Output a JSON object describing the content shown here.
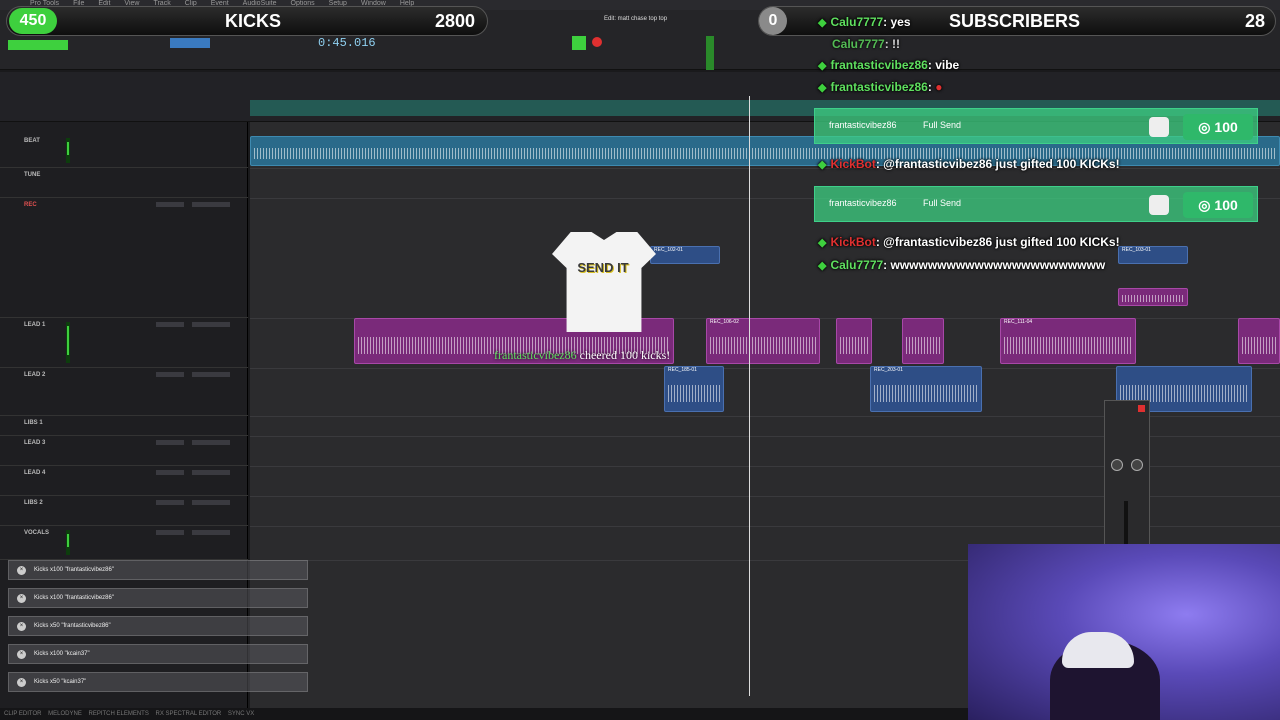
{
  "daw": {
    "menu": [
      "Pro Tools",
      "File",
      "Edit",
      "View",
      "Track",
      "Clip",
      "Event",
      "AudioSuite",
      "Options",
      "Setup",
      "Window",
      "Help"
    ],
    "counter": "0:45.016",
    "title": "Edit: matt chase top top",
    "tracks": [
      {
        "name": "BEAT"
      },
      {
        "name": "TUNE"
      },
      {
        "name": "REC"
      },
      {
        "name": "LEAD 1"
      },
      {
        "name": "LEAD 2"
      },
      {
        "name": "LIBS 1"
      },
      {
        "name": "LEAD 3"
      },
      {
        "name": "LEAD 4"
      },
      {
        "name": "LIBS 2"
      },
      {
        "name": "VOCALS"
      }
    ],
    "clips": [
      "REC_102-01",
      "REC_103-01",
      "REC_104-02",
      "REC_106-02",
      "REC_111-04",
      "REC_185-01",
      "REC_203-01",
      "REC_108-02"
    ],
    "bottom_tabs": [
      "CLIP EDITOR",
      "MELODYNE",
      "REPITCH ELEMENTS",
      "RX SPECTRAL EDITOR",
      "SYNC VX"
    ]
  },
  "overlay": {
    "kicks": {
      "count": "450",
      "label": "KICKS",
      "goal": "2800"
    },
    "subscribers": {
      "count": "0",
      "label": "SUBSCRIBERS",
      "goal": "28"
    },
    "chat": [
      {
        "user": "Calu7777",
        "text": ": yes"
      },
      {
        "user": "Calu7777",
        "text": ": !!"
      },
      {
        "user": "frantasticvibez86",
        "text": ": vibe"
      },
      {
        "user": "frantasticvibez86",
        "text": ": "
      }
    ],
    "gifts": [
      {
        "user": "frantasticvibez86",
        "label": "Full Send",
        "amount": "100"
      },
      {
        "user": "frantasticvibez86",
        "label": "Full Send",
        "amount": "100"
      }
    ],
    "bot_msgs": [
      {
        "user": "KickBot",
        "text": ": @frantasticvibez86 just gifted 100 KICKs!"
      },
      {
        "user": "KickBot",
        "text": ": @frantasticvibez86 just gifted 100 KICKs!"
      }
    ],
    "last_chat": {
      "user": "Calu7777",
      "text": ": wwwwwwwwwwwwwwwwwwwwwww"
    },
    "cheer": {
      "shirt_text": "SEND IT",
      "user": "frantasticvibez86",
      "verb": "cheered",
      "amount": "100",
      "unit": "kicks!"
    },
    "alerts": [
      "Kicks x100 \"frantasticvibez86\"",
      "Kicks x100 \"frantasticvibez86\"",
      "Kicks x50 \"frantasticvibez86\"",
      "Kicks x100 \"kcain37\"",
      "Kicks x50 \"kcain37\""
    ]
  }
}
